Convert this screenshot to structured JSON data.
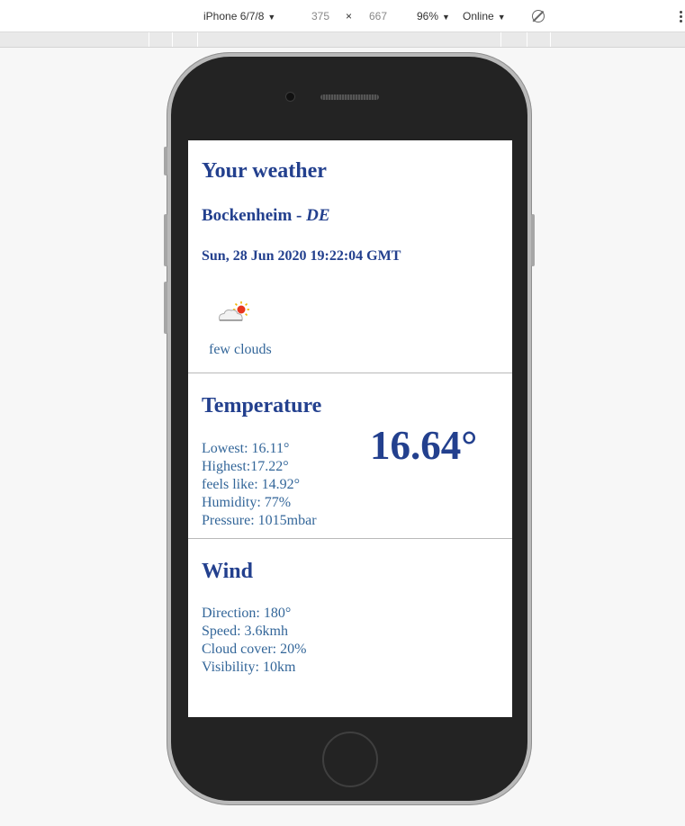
{
  "devtools": {
    "device": "iPhone 6/7/8",
    "width": "375",
    "times": "×",
    "height": "667",
    "zoom": "96%",
    "network": "Online",
    "caret": "▼"
  },
  "header": {
    "title": "Your weather",
    "city": "Bockenheim",
    "separator": " - ",
    "country": "DE",
    "datetime": "Sun, 28 Jun 2020 19:22:04 GMT",
    "icon": "few-clouds-icon",
    "description": "few clouds"
  },
  "temperature": {
    "title": "Temperature",
    "current": "16.64°",
    "lines": [
      "Lowest: 16.11°",
      "Highest:17.22°",
      "feels like: 14.92°",
      "Humidity: 77%",
      "Pressure: 1015mbar"
    ]
  },
  "wind": {
    "title": "Wind",
    "lines": [
      "Direction: 180°",
      "Speed: 3.6kmh",
      "Cloud cover: 20%",
      "Visibility: 10km"
    ]
  },
  "colors": {
    "heading": "#23408e",
    "text": "#336699",
    "divider": "#b9b9b9"
  }
}
